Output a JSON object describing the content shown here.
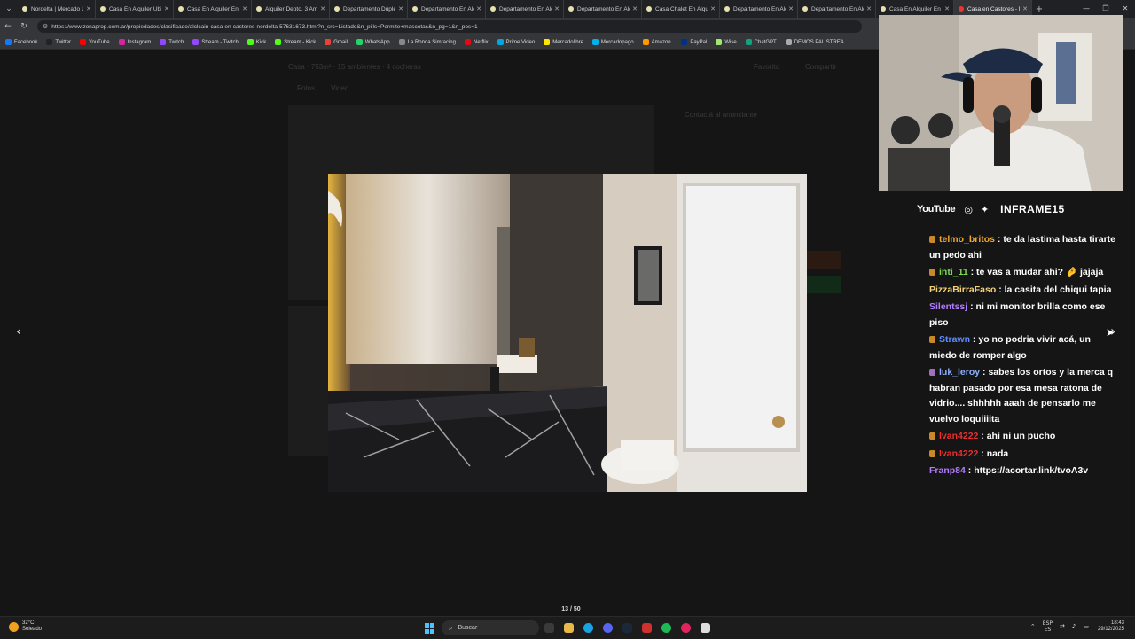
{
  "tabs": [
    {
      "label": "Nordelta | Mercado Lib",
      "active": false
    },
    {
      "label": "Casa En Alquiler Ubica",
      "active": false
    },
    {
      "label": "Casa En Alquiler En Ca",
      "active": false
    },
    {
      "label": "Alquiler Depto. 3 Amb",
      "active": false
    },
    {
      "label": "Departamento Dúplex",
      "active": false
    },
    {
      "label": "Departamento En Alqu",
      "active": false
    },
    {
      "label": "Departamento En Alqu",
      "active": false
    },
    {
      "label": "Departamento En Alqu",
      "active": false
    },
    {
      "label": "Casa Chalet En Alquiler",
      "active": false
    },
    {
      "label": "Departamento En Alqu",
      "active": false
    },
    {
      "label": "Departamento En Alqu",
      "active": false
    },
    {
      "label": "Casa En Alquiler En Pu",
      "active": false
    },
    {
      "label": "Casa en Castores - No",
      "active": true
    }
  ],
  "address": {
    "url": "https://www.zonaprop.com.ar/propiedades/clasificado/alclcain-casa-en-castores-nordelta-57631673.html?n_src=Listado&n_pills=Permite+mascotas&n_pg=1&n_pos=1"
  },
  "bookmarks": [
    {
      "label": "Facebook",
      "color": "#1877f2"
    },
    {
      "label": "Twitter",
      "color": "#222222"
    },
    {
      "label": "YouTube",
      "color": "#ff0000"
    },
    {
      "label": "Instagram",
      "color": "#d6249f"
    },
    {
      "label": "Twitch",
      "color": "#9146ff"
    },
    {
      "label": "Stream - Twitch",
      "color": "#9146ff"
    },
    {
      "label": "Kick",
      "color": "#53fc18"
    },
    {
      "label": "Stream - Kick",
      "color": "#53fc18"
    },
    {
      "label": "Gmail",
      "color": "#ea4335"
    },
    {
      "label": "WhatsApp",
      "color": "#25d366"
    },
    {
      "label": "La Ronda Simracing",
      "color": "#888888"
    },
    {
      "label": "Netflix",
      "color": "#e50914"
    },
    {
      "label": "Prime Video",
      "color": "#00a8e1"
    },
    {
      "label": "Mercadolibre",
      "color": "#ffe600"
    },
    {
      "label": "Mercadopago",
      "color": "#00b1ea"
    },
    {
      "label": "Amazon.",
      "color": "#ff9900"
    },
    {
      "label": "PayPal",
      "color": "#003087"
    },
    {
      "label": "Wise",
      "color": "#9fe870"
    },
    {
      "label": "ChatGPT",
      "color": "#10a37f"
    },
    {
      "label": "DEMOS PAL STREA...",
      "color": "#aaaaaa"
    }
  ],
  "page": {
    "listing_title": "Casa · 753m² · 15 ambientes · 4 cocheras",
    "favorite": "Favorito",
    "share": "Compartir",
    "tab_photos": "Fotos",
    "tab_video": "Video",
    "contact_title": "Contactá al anunciante"
  },
  "gallery": {
    "counter": "13 / 50"
  },
  "stream": {
    "socials_youtube": "YouTube",
    "channel_name": "INFRAME15",
    "chat": [
      {
        "user": "telmo_britos",
        "text": "te da lastima hasta tirarte un pedo ahi",
        "color": "#f0a830",
        "badge": "#c9882a"
      },
      {
        "user": "inti_11",
        "text": "te vas a mudar ahi? 🤌 jajaja",
        "color": "#7fd957",
        "badge": "#c9882a"
      },
      {
        "user": "PizzaBirraFaso",
        "text": "la casita del chiqui tapia",
        "color": "#f5d27a",
        "badge": ""
      },
      {
        "user": "Silentssj",
        "text": "ni mi monitor brilla como ese piso",
        "color": "#b37cff",
        "badge": ""
      },
      {
        "user": "Strawn",
        "text": "yo no podria vivir acá, un miedo de romper algo",
        "color": "#5f8cff",
        "badge": "#c9882a"
      },
      {
        "user": "luk_leroy",
        "text": "sabes los ortos y la merca q habran pasado por esa mesa ratona de vidrio.... shhhhh aaah de pensarlo me vuelvo loquiiiita",
        "color": "#8fb0ff",
        "badge": "#a070c0"
      },
      {
        "user": "Ivan4222",
        "text": "ahi ni un pucho",
        "color": "#e83030",
        "badge": "#c9882a"
      },
      {
        "user": "Ivan4222",
        "text": "nada",
        "color": "#e83030",
        "badge": "#c9882a"
      },
      {
        "user": "Franp84",
        "text": "https://acortar.link/tvoA3v",
        "color": "#b37cff",
        "badge": ""
      }
    ]
  },
  "taskbar": {
    "temp": "32°C",
    "weather": "Soleado",
    "search_placeholder": "Buscar",
    "lang": "ESP",
    "lang_sub": "ES",
    "time": "18:43",
    "date": "29/12/2025"
  }
}
